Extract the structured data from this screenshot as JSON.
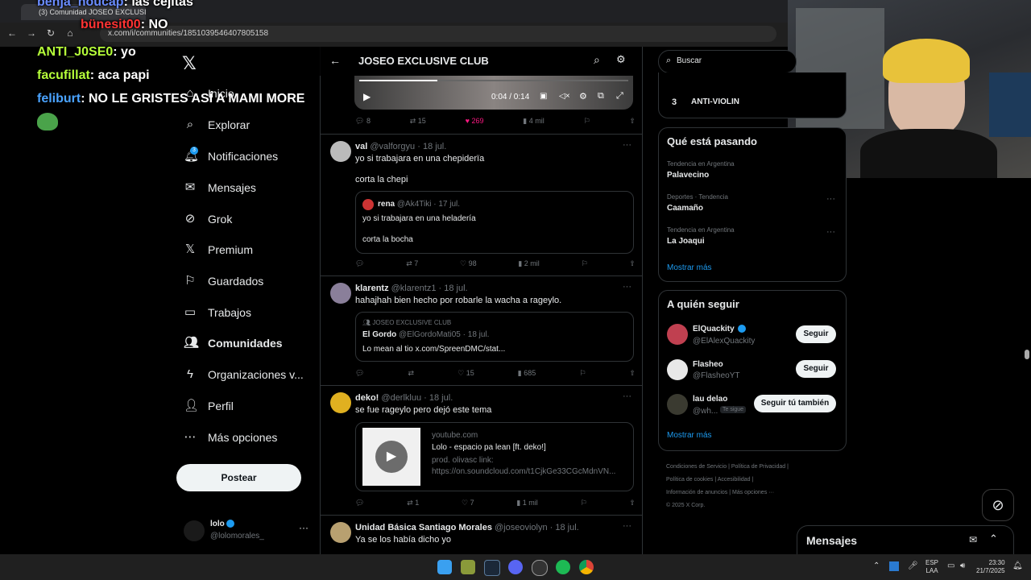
{
  "browser": {
    "tab_title": "(3) Comunidad JOSEO EXCLUSI",
    "url": "x.com/i/communities/1851039546407805158"
  },
  "chat": [
    {
      "user": "benja_noucap",
      "message": ": las cejitas"
    },
    {
      "user": "bünesit00",
      "message": ": NO"
    },
    {
      "user": "ANTI_J0SE0",
      "message": ": yo"
    },
    {
      "user": "facufillat",
      "message": ": aca papi"
    },
    {
      "user": "feliburt",
      "message": ": NO LE GRISTES ASÍ A MAMI MORE"
    }
  ],
  "nav": {
    "items": [
      {
        "label": "Inicio",
        "icon": "home-icon"
      },
      {
        "label": "Explorar",
        "icon": "search-icon"
      },
      {
        "label": "Notificaciones",
        "icon": "bell-icon",
        "badge": "3"
      },
      {
        "label": "Mensajes",
        "icon": "mail-icon"
      },
      {
        "label": "Grok",
        "icon": "grok-icon"
      },
      {
        "label": "Premium",
        "icon": "x-logo-icon"
      },
      {
        "label": "Guardados",
        "icon": "bookmark-icon"
      },
      {
        "label": "Trabajos",
        "icon": "briefcase-icon"
      },
      {
        "label": "Comunidades",
        "icon": "communities-icon"
      },
      {
        "label": "Organizaciones v...",
        "icon": "lightning-icon"
      },
      {
        "label": "Perfil",
        "icon": "person-icon"
      },
      {
        "label": "Más opciones",
        "icon": "more-circle-icon"
      }
    ],
    "post_label": "Postear",
    "account": {
      "name": "lolo",
      "handle": "@lolomorales_"
    }
  },
  "header": {
    "title": "JOSEO EXCLUSIVE CLUB"
  },
  "video": {
    "time": "0:04 / 0:14",
    "progress": 0.29
  },
  "tweets": [
    {
      "stats": {
        "replies": "8",
        "retweets": "15",
        "likes": "269",
        "views": "4 mil"
      }
    },
    {
      "name": "val",
      "handle": "@valforgyu",
      "date": "· 18 jul.",
      "text1": "yo si trabajara en una chepiderïa",
      "text2": "corta la chepi",
      "quote": {
        "name": "rena",
        "handle": "@Ak4Tiki",
        "date": "· 17 jul.",
        "text1": "yo si trabajara en una heladería",
        "text2": "corta la bocha"
      },
      "stats": {
        "replies": "",
        "retweets": "7",
        "likes": "98",
        "views": "2 mil"
      }
    },
    {
      "name": "klarentz",
      "handle": "@klarentz1",
      "date": "· 18 jul.",
      "text1": "hahajhah bien hecho por robarle la wacha a rageylo.",
      "quote": {
        "community": "JOSEO EXCLUSIVE CLUB",
        "name": "El Gordo",
        "handle": "@ElGordoMati05",
        "date": "· 18 jul.",
        "text1": "Lo mean al tio x.com/SpreenDMC/stat..."
      },
      "stats": {
        "replies": "",
        "retweets": "",
        "likes": "15",
        "views": "685"
      }
    },
    {
      "name": "deko!",
      "handle": "@derlkluu",
      "date": "· 18 jul.",
      "text1": "se fue rageylo pero dejó este tema",
      "card": {
        "domain": "youtube.com",
        "title": "Lolo - espacio pa lean [ft. deko!]",
        "desc": "prod. olivasc link: https://on.soundcloud.com/t1CjkGe33CGcMdnVN..."
      },
      "stats": {
        "replies": "",
        "retweets": "1",
        "likes": "7",
        "views": "1 mil"
      }
    },
    {
      "name": "Unidad Básica Santiago Morales",
      "handle": "@joseoviolyn",
      "date": "· 18 jul.",
      "text1": "Ya se los había dicho yo"
    }
  ],
  "right": {
    "search_placeholder": "Buscar",
    "trend_top": {
      "rank": "3",
      "name": "ANTI-VIOLIN"
    },
    "whats_happening": {
      "title": "Qué está pasando",
      "trends": [
        {
          "context": "Tendencia en Argentina",
          "name": "Palavecino"
        },
        {
          "context": "Deportes · Tendencia",
          "name": "Caamaño"
        },
        {
          "context": "Tendencia en Argentina",
          "name": "La Joaqui"
        }
      ],
      "more": "Mostrar más"
    },
    "who_to_follow": {
      "title": "A quién seguir",
      "users": [
        {
          "name": "ElQuackity",
          "handle": "@ElAlexQuackity",
          "button": "Seguir"
        },
        {
          "name": "Flasheo",
          "handle": "@FlasheoYT",
          "button": "Seguir"
        },
        {
          "name": "lau delao",
          "handle": "@wh...",
          "tag": "Te sigue",
          "button": "Seguir tú también"
        }
      ],
      "more": "Mostrar más"
    },
    "footer": {
      "links": [
        "Condiciones de Servicio",
        "Política de Privacidad",
        "Política de cookies",
        "Accesibilidad",
        "Información de anuncios",
        "Más opciones ···"
      ],
      "copyright": "© 2025 X Corp."
    },
    "messages": "Mensajes"
  },
  "taskbar": {
    "lang": "ESP",
    "lang2": "LAA",
    "time": "23:30",
    "date": "21/7/2025"
  }
}
